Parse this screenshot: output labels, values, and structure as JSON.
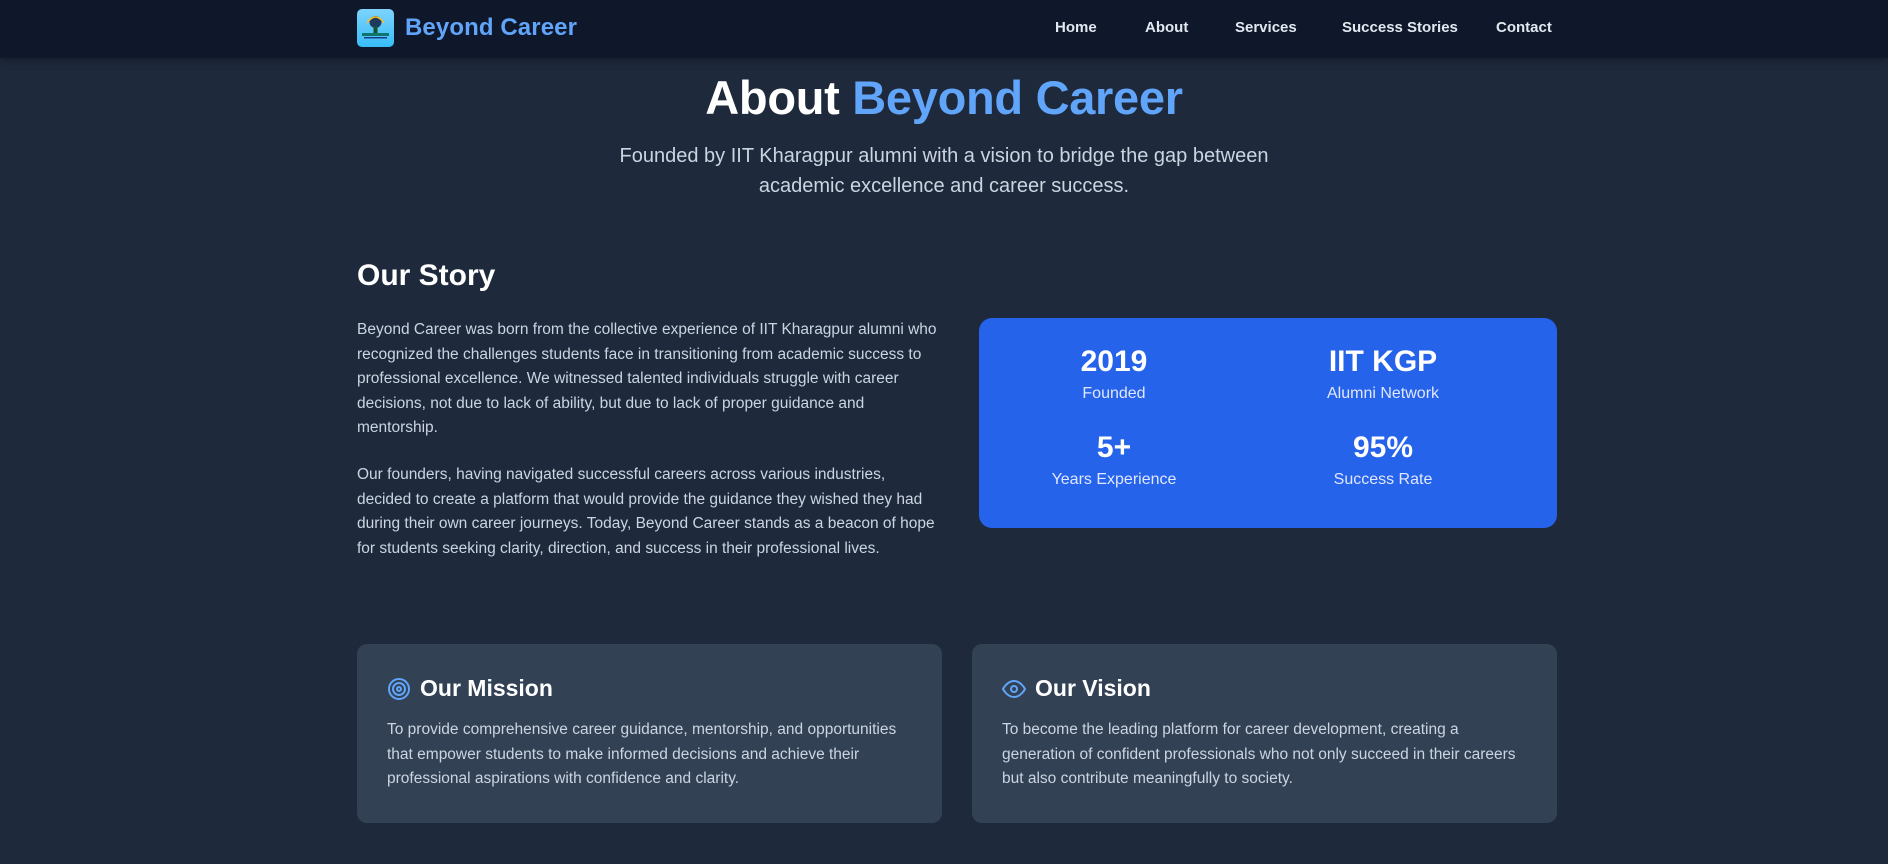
{
  "nav": {
    "brand": "Beyond Career",
    "logo_icon": "logo-badge",
    "links": [
      {
        "label": "Home"
      },
      {
        "label": "About"
      },
      {
        "label": "Services"
      },
      {
        "label": "Success Stories"
      },
      {
        "label": "Contact"
      }
    ]
  },
  "hero": {
    "title_prefix": "About",
    "title_accent": "Beyond Career",
    "subtitle": "Founded by IIT Kharagpur alumni with a vision to bridge the gap between academic excellence and career success."
  },
  "story": {
    "title": "Our Story",
    "paragraphs": [
      "Beyond Career was born from the collective experience of IIT Kharagpur alumni who recognized the challenges students face in transitioning from academic success to professional excellence. We witnessed talented individuals struggle with career decisions, not due to lack of ability, but due to lack of proper guidance and mentorship.",
      "Our founders, having navigated successful careers across various industries, decided to create a platform that would provide the guidance they wished they had during their own career journeys. Today, Beyond Career stands as a beacon of hope for students seeking clarity, direction, and success in their professional lives."
    ]
  },
  "stats": [
    {
      "value": "2019",
      "label": "Founded"
    },
    {
      "value": "IIT KGP",
      "label": "Alumni Network"
    },
    {
      "value": "5+",
      "label": "Years Experience"
    },
    {
      "value": "95%",
      "label": "Success Rate"
    }
  ],
  "mission": {
    "icon": "target-icon",
    "title": "Our Mission",
    "text": "To provide comprehensive career guidance, mentorship, and opportunities that empower students to make informed decisions and achieve their professional aspirations with confidence and clarity."
  },
  "vision": {
    "icon": "eye-icon",
    "title": "Our Vision",
    "text": "To become the leading platform for career development, creating a generation of confident professionals who not only succeed in their careers but also contribute meaningfully to society."
  },
  "colors": {
    "background": "#1e293b",
    "navbar": "#0f172a",
    "accent": "#60a5fa",
    "stats_card": "#2563eb",
    "card": "#334155"
  }
}
